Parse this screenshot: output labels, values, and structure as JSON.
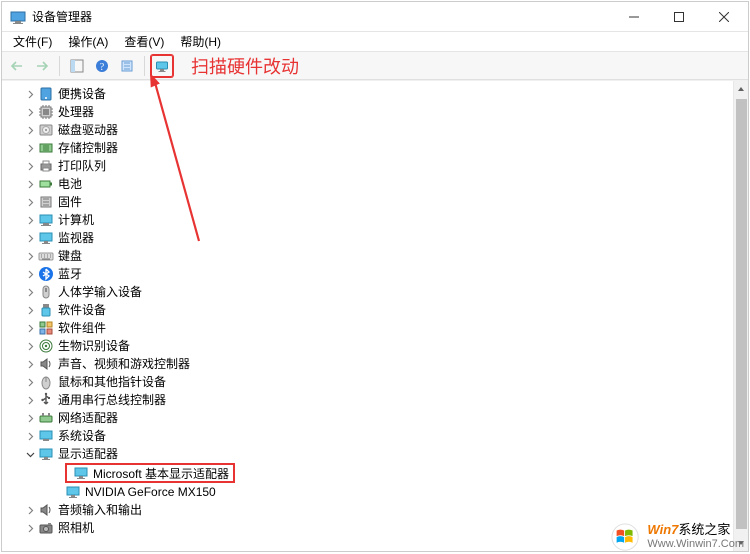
{
  "window": {
    "title": "设备管理器"
  },
  "menu": {
    "file": "文件(F)",
    "action": "操作(A)",
    "view": "查看(V)",
    "help": "帮助(H)"
  },
  "annotation": {
    "label": "扫描硬件改动"
  },
  "tree": {
    "items": [
      {
        "icon": "portable",
        "label": "便携设备"
      },
      {
        "icon": "cpu",
        "label": "处理器"
      },
      {
        "icon": "disk",
        "label": "磁盘驱动器"
      },
      {
        "icon": "storage",
        "label": "存储控制器"
      },
      {
        "icon": "print",
        "label": "打印队列"
      },
      {
        "icon": "battery",
        "label": "电池"
      },
      {
        "icon": "firmware",
        "label": "固件"
      },
      {
        "icon": "computer",
        "label": "计算机"
      },
      {
        "icon": "monitor",
        "label": "监视器"
      },
      {
        "icon": "keyboard",
        "label": "键盘"
      },
      {
        "icon": "bluetooth",
        "label": "蓝牙"
      },
      {
        "icon": "hid",
        "label": "人体学输入设备"
      },
      {
        "icon": "usbdevice",
        "label": "软件设备"
      },
      {
        "icon": "component",
        "label": "软件组件"
      },
      {
        "icon": "biometric",
        "label": "生物识别设备"
      },
      {
        "icon": "sound",
        "label": "声音、视频和游戏控制器"
      },
      {
        "icon": "mouse",
        "label": "鼠标和其他指针设备"
      },
      {
        "icon": "usb",
        "label": "通用串行总线控制器"
      },
      {
        "icon": "network",
        "label": "网络适配器"
      },
      {
        "icon": "system",
        "label": "系统设备"
      }
    ],
    "display": {
      "label": "显示适配器",
      "children": [
        "Microsoft 基本显示适配器",
        "NVIDIA GeForce MX150"
      ]
    },
    "tail": [
      {
        "icon": "sound",
        "label": "音频输入和输出"
      },
      {
        "icon": "camera",
        "label": "照相机"
      }
    ]
  },
  "watermark": {
    "brand_prefix": "Win",
    "brand_num": "7",
    "brand_suffix": "系统之家",
    "url": "Www.Winwin7.Com"
  }
}
